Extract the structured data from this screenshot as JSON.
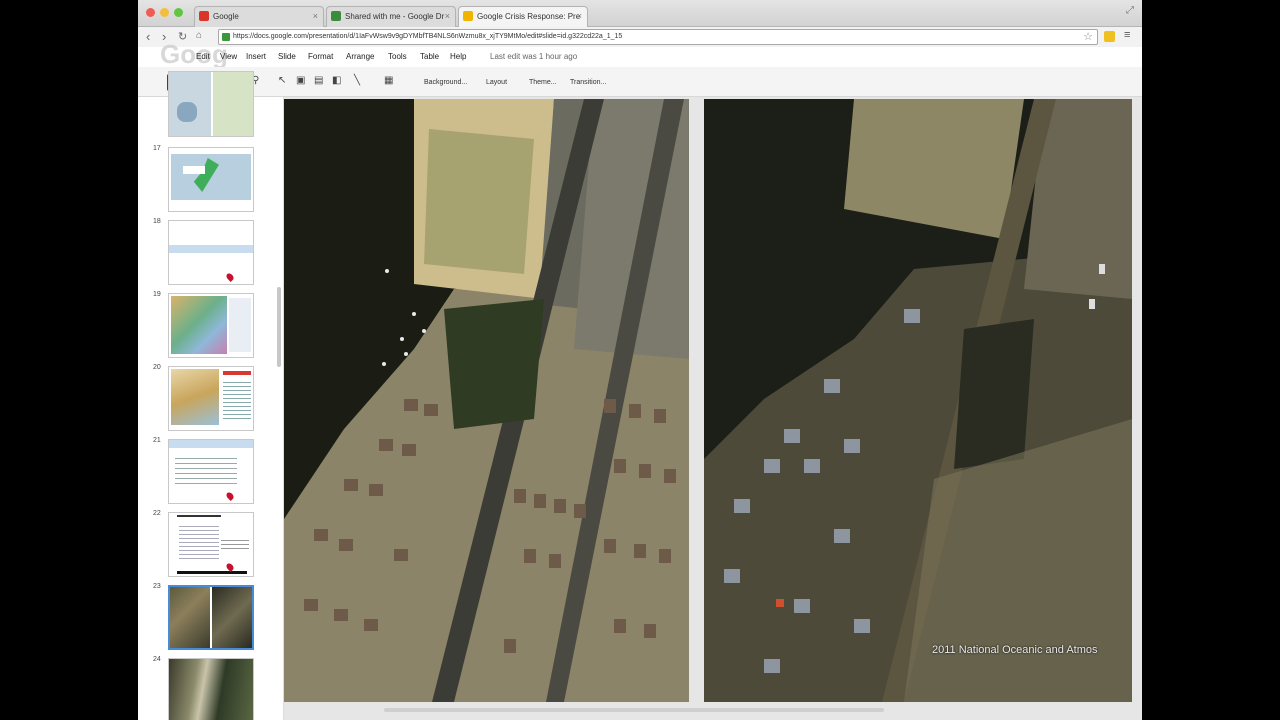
{
  "browser": {
    "tabs": [
      {
        "label": "Google",
        "favicon_color": "#d9362a"
      },
      {
        "label": "Shared with me - Google Dr",
        "favicon_color": "#3b8d3b"
      },
      {
        "label": "Google Crisis Response: Pre",
        "favicon_color": "#f0b400"
      }
    ],
    "url": "https://docs.google.com/presentation/d/1IaFvWsw9v9gDYMbfTB4NLS6nWzmu8x_xjTY9MtMo/edit#slide=id.g322cd22a_1_15"
  },
  "docs": {
    "menu": [
      "File",
      "Edit",
      "View",
      "Insert",
      "Slide",
      "Format",
      "Arrange",
      "Tools",
      "Table",
      "Help"
    ],
    "last_edit": "Last edit was 1 hour ago",
    "toolbar": {
      "background_label": "Background...",
      "layout_label": "Layout",
      "theme_label": "Theme...",
      "transition_label": "Transition..."
    }
  },
  "filmstrip": {
    "slides": [
      {
        "number": "",
        "kind": "maps"
      },
      {
        "number": "17",
        "kind": "map-green"
      },
      {
        "number": "18",
        "kind": "banner-pin"
      },
      {
        "number": "19",
        "kind": "satellite-color"
      },
      {
        "number": "20",
        "kind": "map-list"
      },
      {
        "number": "21",
        "kind": "text-pin"
      },
      {
        "number": "22",
        "kind": "doc-pin"
      },
      {
        "number": "23",
        "kind": "aerial-pair",
        "selected": true
      },
      {
        "number": "24",
        "kind": "aerial-single"
      }
    ]
  },
  "slide": {
    "credit": "2011 National Oceanic and Atmos"
  },
  "colors": {
    "accent_red": "#d62b2b",
    "selection_blue": "#4a8bd8"
  }
}
